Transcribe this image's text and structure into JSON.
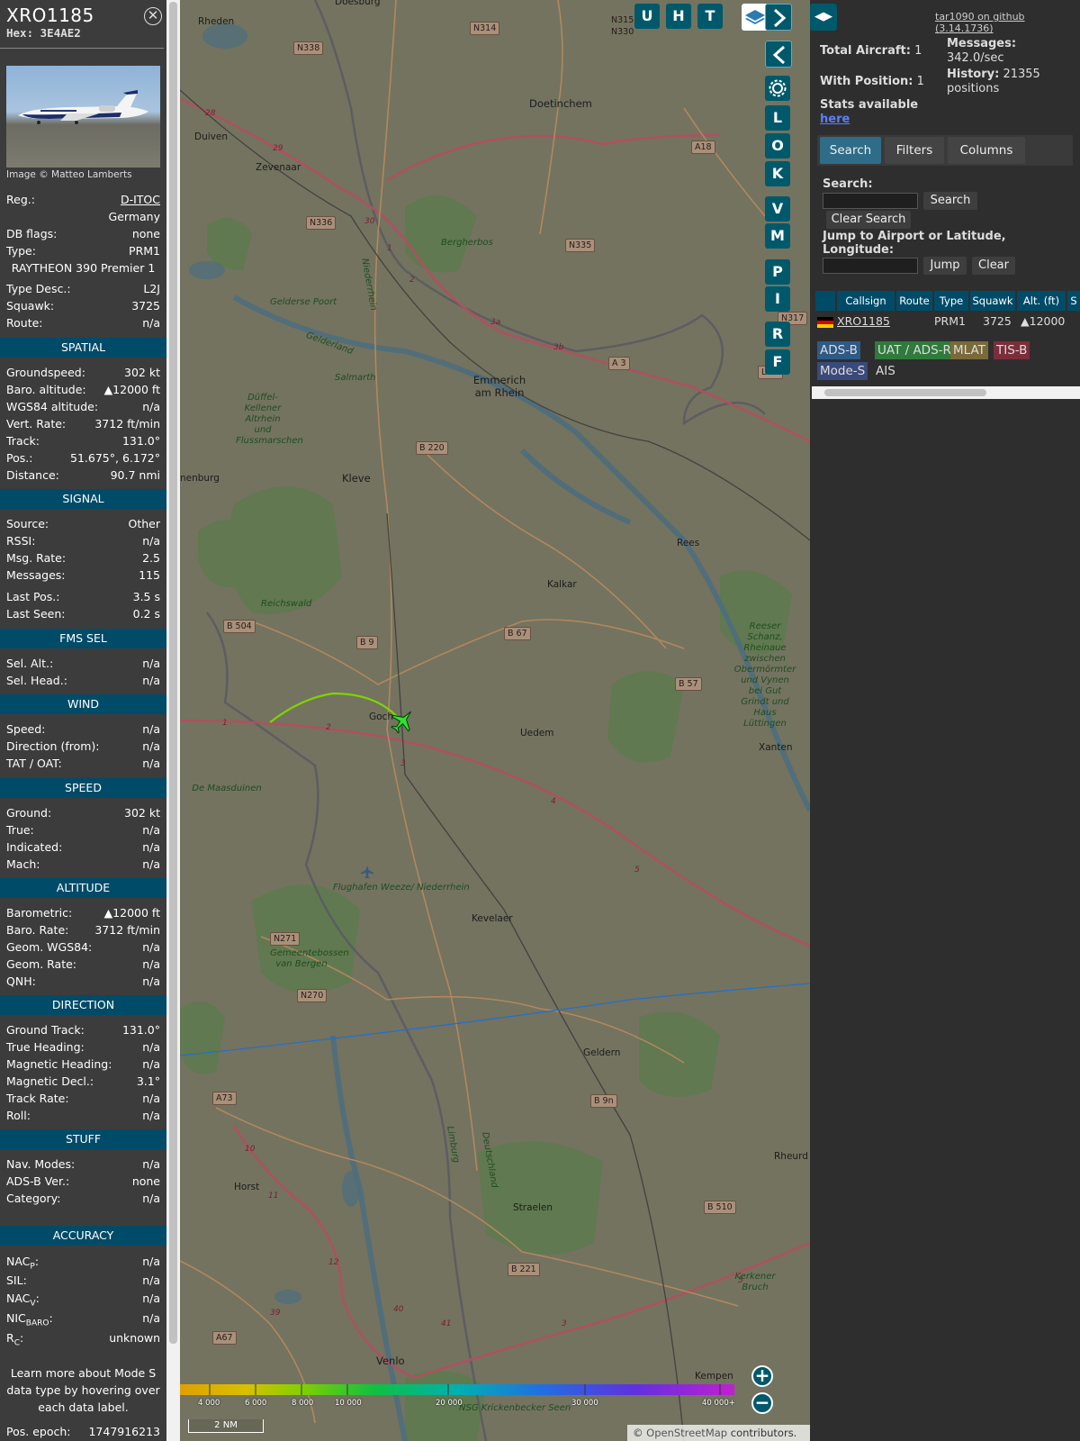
{
  "info": {
    "callsign": "XRO1185",
    "hex_label": "Hex:",
    "hex": "3E4AE2",
    "image_credit": "Image © Matteo Lamberts",
    "reg_label": "Reg.:",
    "reg": "D-ITOC",
    "country": "Germany",
    "dbflags_label": "DB flags:",
    "dbflags": "none",
    "type_label": "Type:",
    "type": "PRM1",
    "type_full": "RAYTHEON 390 Premier 1",
    "typedesc_label": "Type Desc.:",
    "typedesc": "L2J",
    "squawk_label": "Squawk:",
    "squawk": "3725",
    "route_label": "Route:",
    "route": "n/a",
    "sections": {
      "spatial": "SPATIAL",
      "signal": "SIGNAL",
      "fms": "FMS SEL",
      "wind": "WIND",
      "speed": "SPEED",
      "altitude": "ALTITUDE",
      "direction": "DIRECTION",
      "stuff": "STUFF",
      "accuracy": "ACCURACY"
    },
    "spatial": [
      {
        "k": "Groundspeed:",
        "v": "302 kt"
      },
      {
        "k": "Baro. altitude:",
        "v": "▲12000 ft"
      },
      {
        "k": "WGS84 altitude:",
        "v": "n/a"
      },
      {
        "k": "Vert. Rate:",
        "v": "3712 ft/min"
      },
      {
        "k": "Track:",
        "v": "131.0°"
      },
      {
        "k": "Pos.:",
        "v": "51.675°, 6.172°"
      },
      {
        "k": "Distance:",
        "v": "90.7 nmi"
      }
    ],
    "signal": [
      {
        "k": "Source:",
        "v": "Other"
      },
      {
        "k": "RSSI:",
        "v": "n/a"
      },
      {
        "k": "Msg. Rate:",
        "v": "2.5"
      },
      {
        "k": "Messages:",
        "v": "115"
      },
      {
        "k": "Last Pos.:",
        "v": "3.5 s"
      },
      {
        "k": "Last Seen:",
        "v": "0.2 s"
      }
    ],
    "fms": [
      {
        "k": "Sel. Alt.:",
        "v": "n/a"
      },
      {
        "k": "Sel. Head.:",
        "v": "n/a"
      }
    ],
    "wind": [
      {
        "k": "Speed:",
        "v": "n/a"
      },
      {
        "k": "Direction (from):",
        "v": "n/a"
      },
      {
        "k": "TAT / OAT:",
        "v": "n/a"
      }
    ],
    "speed": [
      {
        "k": "Ground:",
        "v": "302 kt"
      },
      {
        "k": "True:",
        "v": "n/a"
      },
      {
        "k": "Indicated:",
        "v": "n/a"
      },
      {
        "k": "Mach:",
        "v": "n/a"
      }
    ],
    "altitude": [
      {
        "k": "Barometric:",
        "v": "▲12000 ft"
      },
      {
        "k": "Baro. Rate:",
        "v": "3712 ft/min"
      },
      {
        "k": "Geom. WGS84:",
        "v": "n/a"
      },
      {
        "k": "Geom. Rate:",
        "v": "n/a"
      },
      {
        "k": "QNH:",
        "v": "n/a"
      }
    ],
    "direction": [
      {
        "k": "Ground Track:",
        "v": "131.0°"
      },
      {
        "k": "True Heading:",
        "v": "n/a"
      },
      {
        "k": "Magnetic Heading:",
        "v": "n/a"
      },
      {
        "k": "Magnetic Decl.:",
        "v": "3.1°"
      },
      {
        "k": "Track Rate:",
        "v": "n/a"
      },
      {
        "k": "Roll:",
        "v": "n/a"
      }
    ],
    "stuff": [
      {
        "k": "Nav. Modes:",
        "v": "n/a"
      },
      {
        "k": "ADS-B Ver.:",
        "v": "none"
      },
      {
        "k": "Category:",
        "v": "n/a"
      }
    ],
    "accuracy": [
      {
        "k": "NAC",
        "sub": "P",
        "v": "n/a"
      },
      {
        "k": "SIL:",
        "sub": "",
        "v": "n/a"
      },
      {
        "k": "NAC",
        "sub": "V",
        "v": "n/a"
      },
      {
        "k": "NIC",
        "sub": "BARO",
        "v": "n/a"
      },
      {
        "k": "R",
        "sub": "C",
        "v": "unknown"
      }
    ],
    "learn_more": "Learn more about Mode S data type by hovering over each data label.",
    "pos_epoch_label": "Pos. epoch:",
    "pos_epoch": "1747916213"
  },
  "map": {
    "buttons_top": [
      "U",
      "H",
      "T"
    ],
    "buttons_side": [
      "L",
      "O",
      "K",
      "V",
      "M",
      "P",
      "I",
      "R",
      "F"
    ],
    "places": [
      "Rheden",
      "Doesburg",
      "Duiven",
      "Zevenaar",
      "Doetinchem",
      "Bergherbos",
      "Gelderse Poort",
      "Emmerich am Rhein",
      "Salmarth",
      "Düffel-Kellener Altrhein und Flussmarschen",
      "Kleve",
      "nenburg",
      "Rees",
      "Kalkar",
      "Reichswald",
      "Reeser Schanz, Rheinaue zwischen Obermörmter und Vynen bei Gut Grindt und Haus Lüttingen",
      "Goch",
      "Uedem",
      "Xanten",
      "De Maasduinen",
      "Flughafen Weeze/ Niederrhein",
      "Kevelaer",
      "Geldern",
      "Gemeentebossen van Bergen",
      "Horst",
      "Straelen",
      "Rheurd",
      "Kerkener Bruch",
      "Venlo",
      "Kempen",
      "NSG Krickenbecker Seen",
      "Gelderland",
      "Niederrhein",
      "Limburg",
      "Deutschland"
    ],
    "roads": [
      "N315",
      "N330",
      "N314",
      "N338",
      "A18",
      "N336",
      "N335",
      "A 3",
      "L 46",
      "B 220",
      "B 504",
      "B 9",
      "B 67",
      "B 57",
      "N271",
      "N270",
      "A73",
      "B 9n",
      "B 510",
      "B 221",
      "A67",
      "N317"
    ],
    "altitude_scale": [
      "4 000",
      "6 000",
      "8 000",
      "10 000",
      "20 000",
      "30 000",
      "40 000+"
    ],
    "scale_label": "2 NM",
    "attribution_symbol": "©",
    "attribution_link": "OpenStreetMap",
    "attribution_rest": "contributors."
  },
  "right": {
    "github": "tar1090 on github (3.14.1736)",
    "total_aircraft_label": "Total Aircraft:",
    "total_aircraft": "1",
    "with_position_label": "With Position:",
    "with_position": "1",
    "messages_label": "Messages:",
    "messages_rate": "342.0/sec",
    "history_label": "History:",
    "history": "21355 positions",
    "stats_label": "Stats available",
    "stats_link": "here",
    "tabs": [
      "Search",
      "Filters",
      "Columns"
    ],
    "search_label": "Search:",
    "search_button": "Search",
    "clear_search_button": "Clear Search",
    "jump_label": "Jump to Airport or Latitude, Longitude:",
    "jump_button": "Jump",
    "clear_button": "Clear",
    "columns": [
      "Callsign",
      "Route",
      "Type",
      "Squawk",
      "Alt. (ft)",
      "S"
    ],
    "row": {
      "callsign": "XRO1185",
      "route": "",
      "type": "PRM1",
      "squawk": "3725",
      "alt": "▲12000"
    },
    "sources": [
      "ADS-B",
      "UAT / ADS-R",
      "MLAT",
      "TIS-B",
      "Mode-S",
      "AIS"
    ]
  },
  "colors": {
    "accent": "#00596b",
    "header": "#004b68",
    "panel": "#3c3c3c"
  }
}
